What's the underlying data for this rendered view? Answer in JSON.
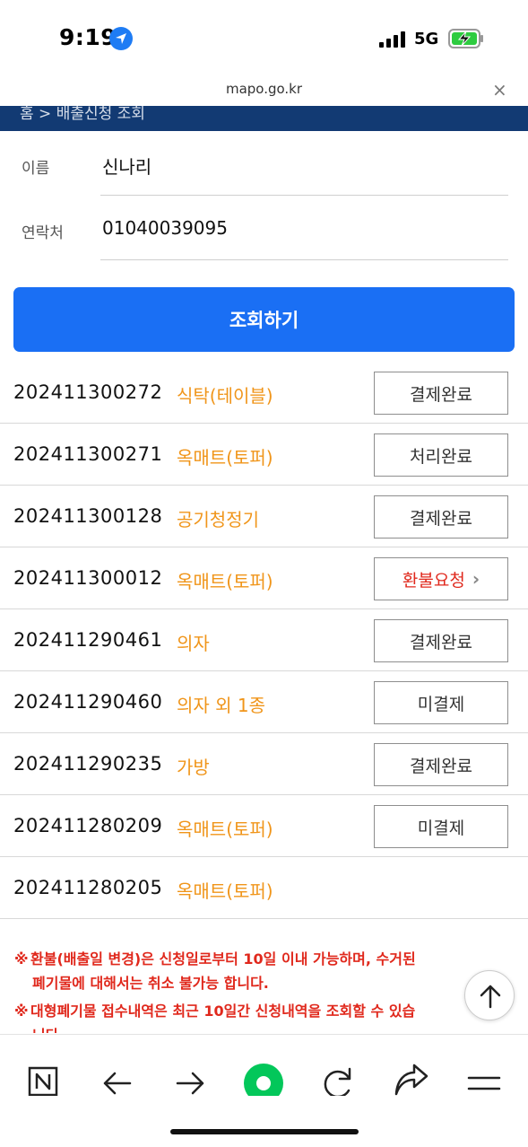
{
  "status_bar": {
    "time": "9:19",
    "network": "5G",
    "icons": [
      "location-icon",
      "signal-icon",
      "battery-charging-icon"
    ]
  },
  "browser": {
    "url": "mapo.go.kr",
    "close_symbol": "×"
  },
  "breadcrumb": "홈 > 배출신청 조회",
  "form": {
    "name_label": "이름",
    "name_value": "신나리",
    "phone_label": "연락처",
    "phone_value": "01040039095"
  },
  "search_button": "조회하기",
  "applications": [
    {
      "number": "202411300272",
      "item": "식탁(테이블)",
      "status": "결제완료"
    },
    {
      "number": "202411300271",
      "item": "옥매트(토퍼)",
      "status": "처리완료"
    },
    {
      "number": "202411300128",
      "item": "공기청정기",
      "status": "결제완료"
    },
    {
      "number": "202411300012",
      "item": "옥매트(토퍼)",
      "status": "환불요청"
    },
    {
      "number": "202411290461",
      "item": "의자",
      "status": "결제완료"
    },
    {
      "number": "202411290460",
      "item": "의자 외 1종",
      "status": "미결제"
    },
    {
      "number": "202411290235",
      "item": "가방",
      "status": "결제완료"
    },
    {
      "number": "202411280209",
      "item": "옥매트(토퍼)",
      "status": "미결제"
    },
    {
      "number": "202411280205",
      "item": "옥매트(토퍼)",
      "status": ""
    }
  ],
  "notices": {
    "mark": "※",
    "refund_line1": "환불(배출일 변경)은 신청일로부터 10일 이내 가능하며, 수거된",
    "refund_line2": "폐기물에 대해서는 취소 불가능 합니다.",
    "history_line1": "대형폐기물 접수내역은 최근 10일간 신청내역을 조회할 수 있습",
    "history_line2": "니다."
  },
  "colors": {
    "accent": "#1a6ff4",
    "header": "#123a73",
    "category": "#f0951a",
    "warning": "#e0281c"
  }
}
